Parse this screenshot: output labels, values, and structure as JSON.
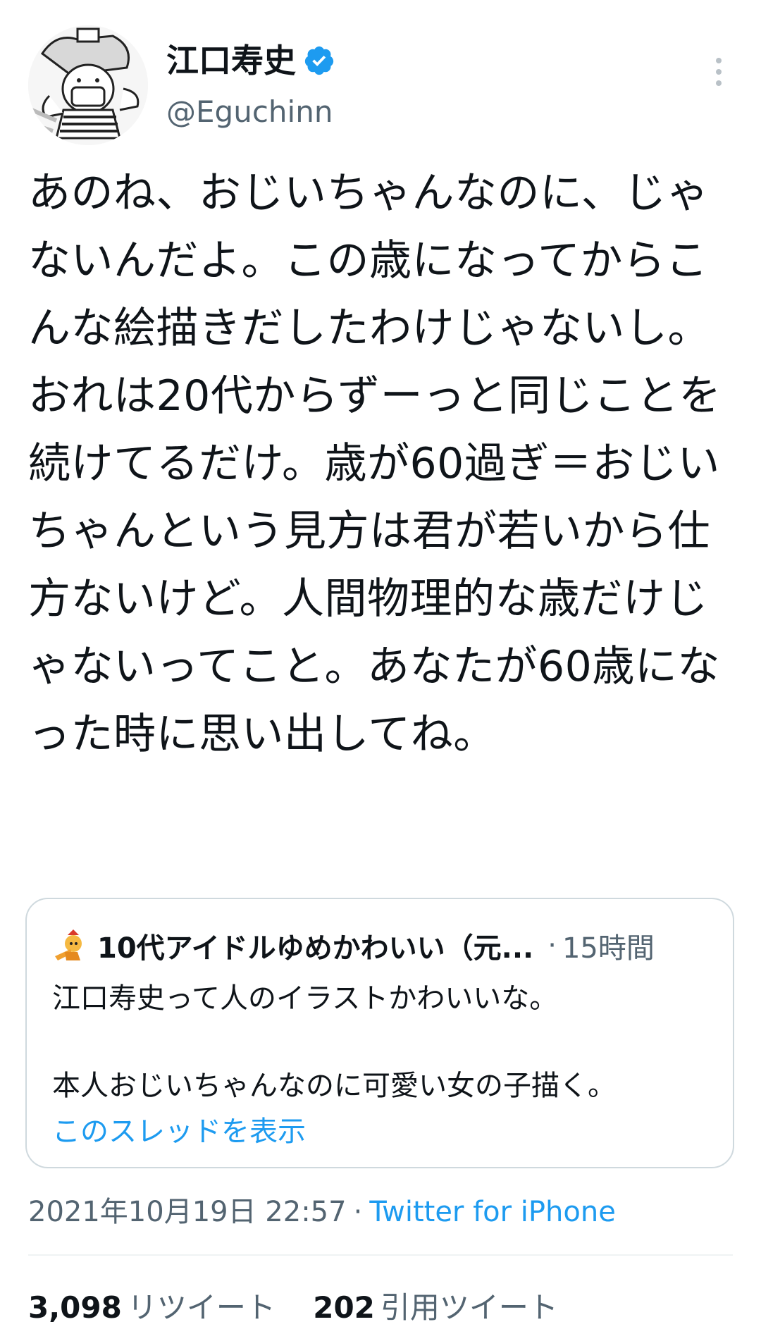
{
  "author": {
    "display_name": "江口寿史",
    "handle": "@Eguchinn",
    "avatar_icon": "cartoon-avatar-icon",
    "verified_icon": "verified-badge-icon",
    "more_icon": "more-options-icon"
  },
  "tweet": {
    "text": "あのね、おじいちゃんなのに、じゃないんだよ。この歳になってからこんな絵描きだしたわけじゃないし。おれは20代からずーっと同じことを続けてるだけ。歳が60過ぎ＝おじいちゃんという見方は君が若いから仕方ないけど。人間物理的な歳だけじゃないってこと。あなたが60歳になった時に思い出してね。"
  },
  "quote": {
    "author_name": "10代アイドルゆめかわいい（元...",
    "separator": "·",
    "time": "15時間",
    "text": "江口寿史って人のイラストかわいいな。\n\n本人おじいちゃんなのに可愛い女の子描く。",
    "show_thread": "このスレッドを表示"
  },
  "meta": {
    "timestamp": "2021年10月19日 22:57",
    "separator": "·",
    "client": "Twitter for iPhone"
  },
  "stats": {
    "retweets_count": "3,098",
    "retweets_label": "リツイート",
    "quotes_count": "202",
    "quotes_label": "引用ツイート"
  },
  "colors": {
    "link_blue": "#1d9bf0",
    "secondary_gray": "#536471",
    "border": "#cfd9de"
  }
}
